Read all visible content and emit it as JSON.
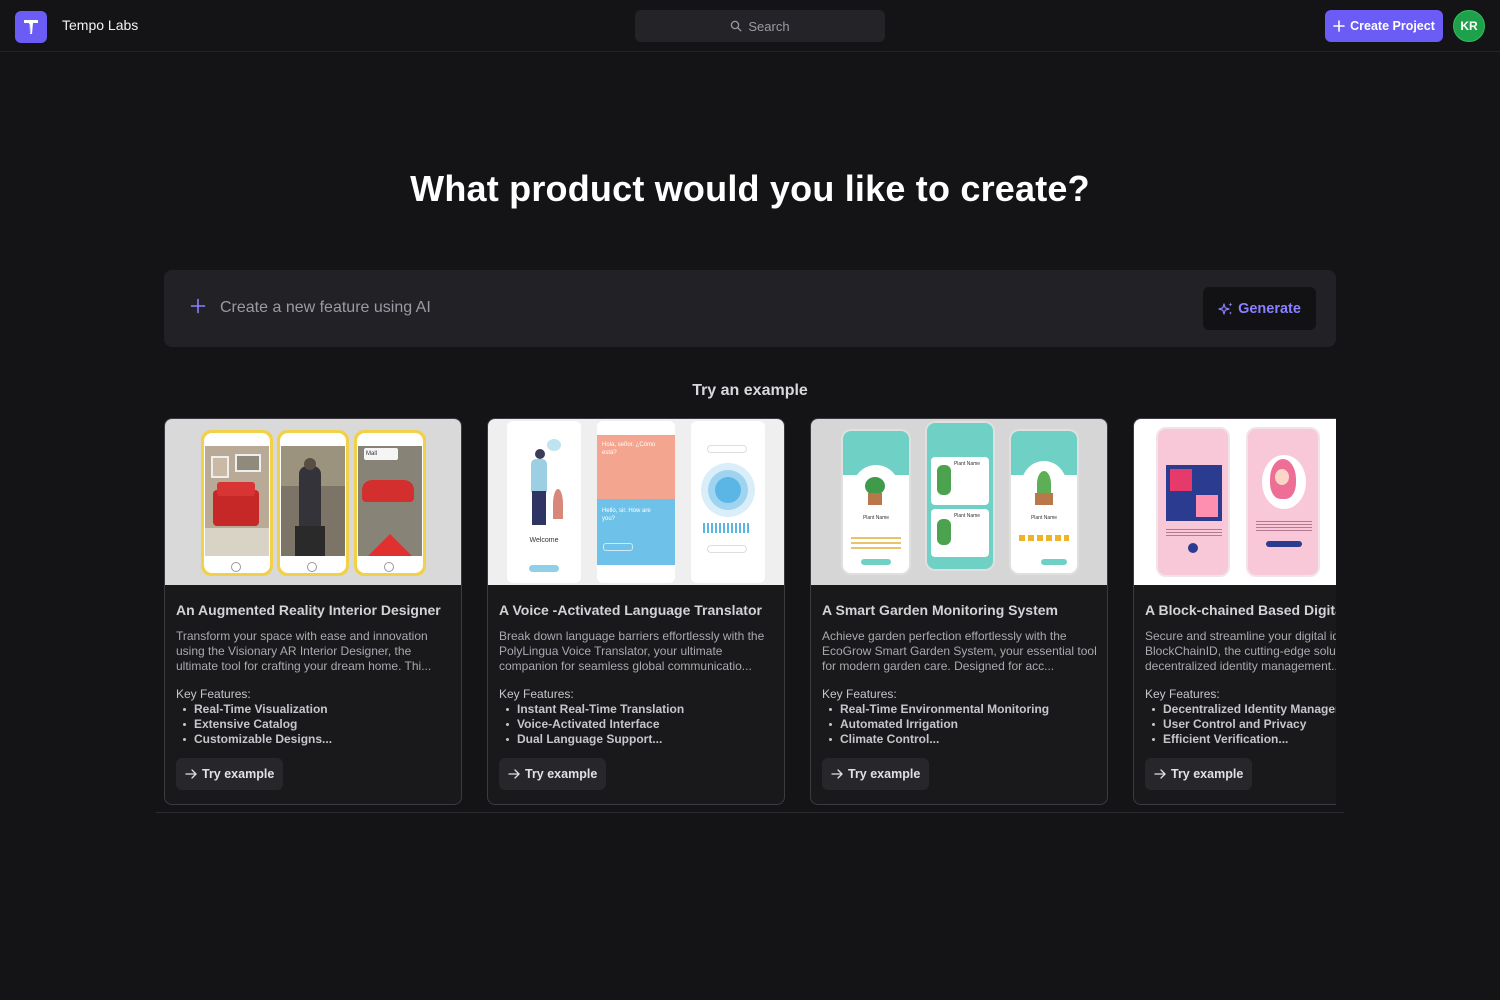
{
  "header": {
    "brand": "Tempo Labs",
    "search_placeholder": "Search",
    "create_label": "Create Project",
    "avatar_initials": "KR"
  },
  "hero": {
    "title": "What product would you like to create?",
    "prompt_placeholder": "Create a new feature using AI",
    "generate_label": "Generate"
  },
  "examples": {
    "heading": "Try an example",
    "try_label": "Try example",
    "features_heading": "Key Features:",
    "cards": [
      {
        "title": "An Augmented Reality Interior Designer",
        "description": "Transform your space with ease and innovation using the Visionary AR Interior Designer, the ultimate tool for crafting your dream home. Thi...",
        "features": [
          "Real-Time Visualization",
          "Extensive Catalog",
          "Customizable Designs..."
        ],
        "mock": {
          "phone3_sign": "Mall"
        }
      },
      {
        "title": "A Voice -Activated Language Translator",
        "description": "Break down language barriers effortlessly with the PolyLingua Voice Translator, your ultimate companion for seamless global communicatio...",
        "features": [
          "Instant Real-Time Translation",
          "Voice-Activated Interface",
          "Dual Language Support..."
        ],
        "mock": {
          "welcome": "Welcome",
          "spanish_text": "Hola, señor. ¿Cómo está?",
          "english_text": "Hello, sir. How are you?"
        }
      },
      {
        "title": "A Smart Garden Monitoring System",
        "description": "Achieve garden perfection effortlessly with the EcoGrow Smart Garden System, your essential tool for modern garden care. Designed for acc...",
        "features": [
          "Real-Time Environmental Monitoring",
          "Automated Irrigation",
          "Climate Control..."
        ],
        "mock": {
          "plant_name": "Plant Name"
        }
      },
      {
        "title": "A Block-chained Based Digital Identity",
        "description": "Secure and streamline your digital identity with BlockChainID, the cutting-edge solution for safe, decentralized identity management...",
        "features": [
          "Decentralized Identity Management",
          "User Control and Privacy",
          "Efficient Verification..."
        ],
        "mock": {}
      }
    ]
  },
  "colors": {
    "accent": "#6a5cf5",
    "generate_text": "#8b80ff",
    "avatar": "#1fa04a",
    "background": "#141417"
  }
}
